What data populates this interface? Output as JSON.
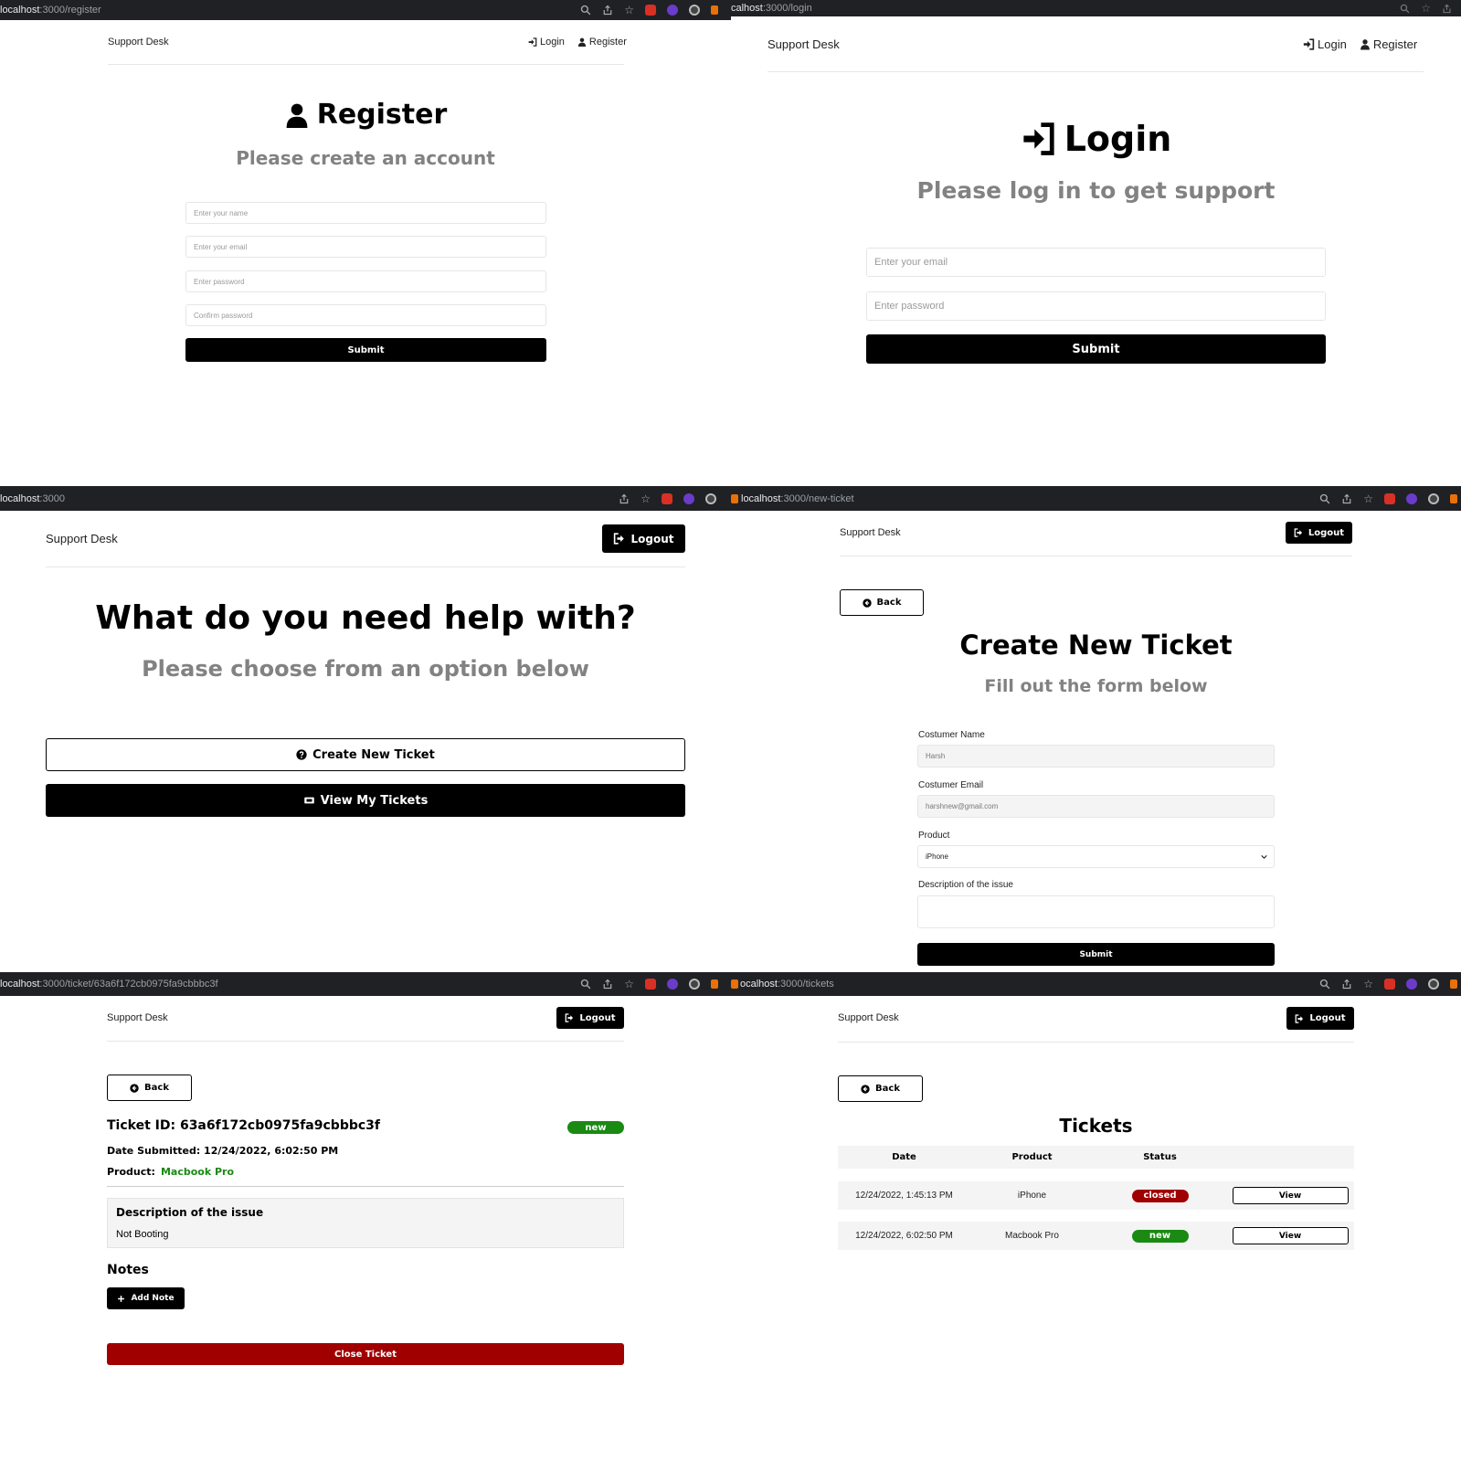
{
  "brand": "Support Desk",
  "nav": {
    "login": "Login",
    "register": "Register",
    "logout": "Logout",
    "back": "Back"
  },
  "register_page": {
    "url_host": "localhost",
    "url_path": ":3000/register",
    "title": "Register",
    "subtitle": "Please create an account",
    "placeholders": {
      "name": "Enter your name",
      "email": "Enter your email",
      "password": "Enter password",
      "confirm": "Confirm password"
    },
    "submit": "Submit"
  },
  "login_page": {
    "url_host": "calhost",
    "url_path": ":3000/login",
    "title": "Login",
    "subtitle": "Please log in to get support",
    "placeholders": {
      "email": "Enter your email",
      "password": "Enter password"
    },
    "submit": "Submit"
  },
  "home_page": {
    "url_host": "localhost",
    "url_path": ":3000",
    "title": "What do you need help with?",
    "subtitle": "Please choose from an option below",
    "create_ticket": "Create New Ticket",
    "view_tickets": "View My Tickets"
  },
  "new_ticket_page": {
    "url_host": "localhost",
    "url_path": ":3000/new-ticket",
    "title": "Create New Ticket",
    "subtitle": "Fill out the form below",
    "name_label": "Costumer Name",
    "name_value": "Harsh",
    "email_label": "Costumer Email",
    "email_value": "harshnew@gmail.com",
    "product_label": "Product",
    "product_value": "iPhone",
    "description_label": "Description of the issue",
    "submit": "Submit"
  },
  "ticket_page": {
    "url_host": "localhost",
    "url_path": ":3000/ticket/63a6f172cb0975fa9cbbbc3f",
    "ticket_id": "Ticket ID: 63a6f172cb0975fa9cbbbc3f",
    "status": "new",
    "date_submitted": "Date Submitted: 12/24/2022, 6:02:50 PM",
    "product_label": "Product:",
    "product_value": "Macbook Pro",
    "description_heading": "Description of the issue",
    "description_text": "Not Booting",
    "notes_heading": "Notes",
    "add_note": "Add Note",
    "close_ticket": "Close Ticket"
  },
  "tickets_page": {
    "url_host": "ocalhost",
    "url_path": ":3000/tickets",
    "title": "Tickets",
    "columns": [
      "Date",
      "Product",
      "Status",
      ""
    ],
    "rows": [
      {
        "date": "12/24/2022, 1:45:13 PM",
        "product": "iPhone",
        "status": "closed",
        "action": "View"
      },
      {
        "date": "12/24/2022, 6:02:50 PM",
        "product": "Macbook Pro",
        "status": "new",
        "action": "View"
      }
    ]
  },
  "colors": {
    "accent": "#000000",
    "subtitle_gray": "#828282",
    "status_new": "#1a8a12",
    "status_closed": "#a00000",
    "browser_bar": "#202124"
  },
  "icons": [
    "user-icon",
    "sign-in-icon",
    "sign-out-icon",
    "question-circle-icon",
    "ticket-icon",
    "arrow-circle-left-icon",
    "plus-icon",
    "search-icon",
    "share-icon",
    "star-icon",
    "chevron-down-icon"
  ]
}
